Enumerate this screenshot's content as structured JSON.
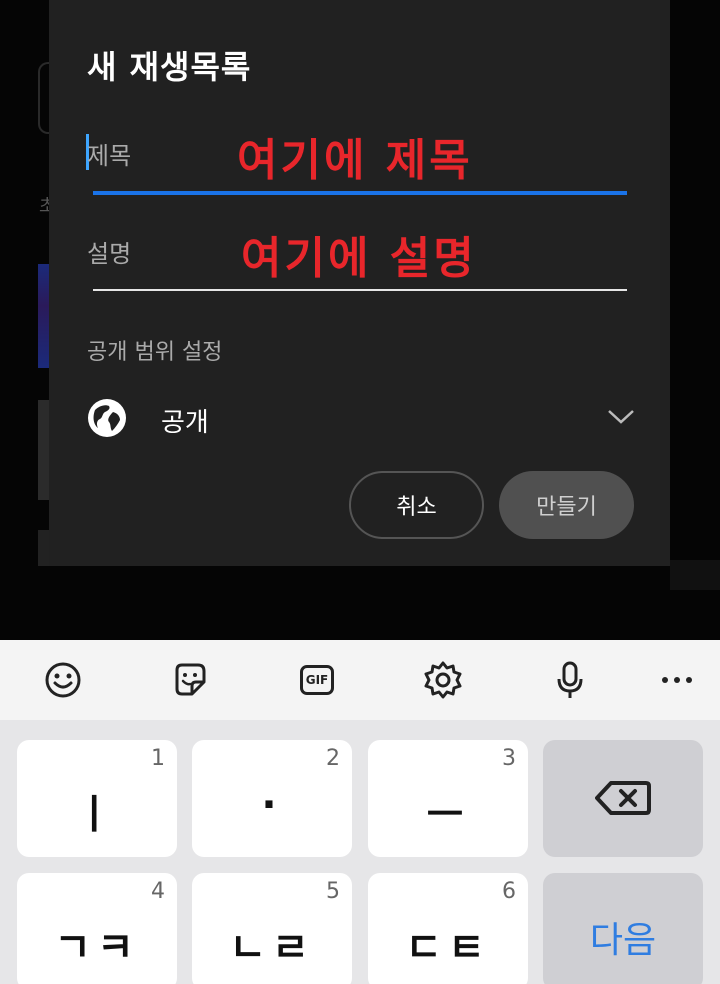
{
  "dialog": {
    "title": "새 재생목록",
    "title_field": {
      "label": "제목",
      "annotation": "여기에 제목"
    },
    "description_field": {
      "label": "설명",
      "annotation": "여기에 설명"
    },
    "visibility": {
      "section_label": "공개 범위 설정",
      "value": "공개",
      "icon": "globe-icon",
      "dropdown_icon": "chevron-down-icon"
    },
    "buttons": {
      "cancel": "취소",
      "create": "만들기"
    }
  },
  "keyboard": {
    "toolbar": [
      "emoji-icon",
      "sticker-icon",
      "gif-icon",
      "settings-icon",
      "microphone-icon",
      "more-icon"
    ],
    "gif_text": "GIF",
    "rows": [
      [
        {
          "hint": "1",
          "label": "ㅣ"
        },
        {
          "hint": "2",
          "label": "·"
        },
        {
          "hint": "3",
          "label": "ㅡ"
        },
        {
          "label": "",
          "icon": "backspace-icon"
        }
      ],
      [
        {
          "hint": "4",
          "label": "ㄱㅋ"
        },
        {
          "hint": "5",
          "label": "ㄴㄹ"
        },
        {
          "hint": "6",
          "label": "ㄷㅌ"
        },
        {
          "label": "다음"
        }
      ]
    ]
  },
  "colors": {
    "accent": "#1a73e8",
    "annotation": "#e8262b",
    "dialog_bg": "#212121",
    "keyboard_bg": "#e6e6e8",
    "next_key_text": "#2f7de1"
  }
}
